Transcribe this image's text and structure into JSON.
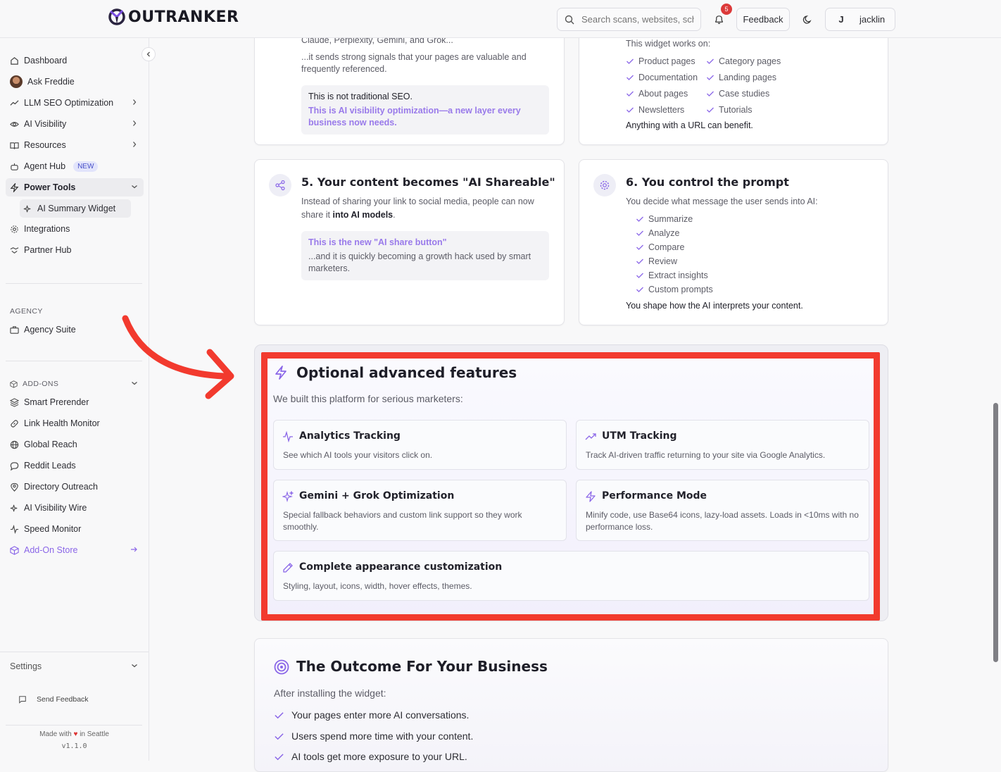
{
  "app": {
    "logo_text": "OUTRANKER"
  },
  "topbar": {
    "search_placeholder": "Search scans, websites, sche",
    "notif_count": "5",
    "feedback_label": "Feedback",
    "user_initial": "J",
    "user_name": "jacklin"
  },
  "sidebar": {
    "items": [
      {
        "label": "Dashboard",
        "icon": "home-icon"
      },
      {
        "label": "Ask Freddie",
        "icon": "avatar"
      },
      {
        "label": "LLM SEO Optimization",
        "icon": "trend-icon"
      },
      {
        "label": "AI Visibility",
        "icon": "eye-icon"
      },
      {
        "label": "Resources",
        "icon": "book-icon"
      },
      {
        "label": "Agent Hub",
        "badge": "NEW",
        "icon": "bot-icon"
      },
      {
        "label": "Power Tools",
        "icon": "zap-icon"
      },
      {
        "label": "AI Summary Widget",
        "icon": "sparkles-icon"
      },
      {
        "label": "Integrations",
        "icon": "gear-icon"
      },
      {
        "label": "Partner Hub",
        "icon": "handshake-icon"
      }
    ],
    "agency_label": "AGENCY",
    "agency_item": "Agency Suite",
    "addons_label": "ADD-ONS",
    "addons": [
      "Smart Prerender",
      "Link Health Monitor",
      "Global Reach",
      "Reddit Leads",
      "Directory Outreach",
      "AI Visibility Wire",
      "Speed Monitor"
    ],
    "addon_store": "Add-On Store",
    "settings_label": "Settings",
    "send_feedback": "Send Feedback",
    "made_with_prefix": "Made with",
    "made_with_suffix": "in Seattle",
    "version": "v1.1.0"
  },
  "card_top_left": {
    "line1": "Claude, Perplexity, Gemini, and Grok...",
    "line2": "...it sends strong signals that your pages are valuable and frequently referenced.",
    "callout_title": "This is not traditional SEO.",
    "callout_body": "This is AI visibility optimization—a new layer every business now needs."
  },
  "card_top_right": {
    "intro": "This widget works on:",
    "col1": [
      "Product pages",
      "Documentation",
      "About pages",
      "Newsletters"
    ],
    "col2": [
      "Category pages",
      "Landing pages",
      "Case studies",
      "Tutorials"
    ],
    "footer": "Anything with a URL can benefit."
  },
  "card5": {
    "title": "5. Your content becomes \"AI Shareable\"",
    "body_prefix": "Instead of sharing your link to social media, people can now share it",
    "body_bold": "into AI models",
    "body_suffix": ".",
    "callout_title": "This is the new \"AI share button\"",
    "callout_body": "...and it is quickly becoming a growth hack used by smart marketers."
  },
  "card6": {
    "title": "6. You control the prompt",
    "intro": "You decide what message the user sends into AI:",
    "items": [
      "Summarize",
      "Analyze",
      "Compare",
      "Review",
      "Extract insights",
      "Custom prompts"
    ],
    "footer": "You shape how the AI interprets your content."
  },
  "advanced": {
    "title": "Optional advanced features",
    "subtitle": "We built this platform for serious marketers:",
    "features": [
      {
        "title": "Analytics Tracking",
        "desc": "See which AI tools your visitors click on.",
        "icon": "activity-icon"
      },
      {
        "title": "UTM Tracking",
        "desc": "Track AI-driven traffic returning to your site via Google Analytics.",
        "icon": "trending-up-icon"
      },
      {
        "title": "Gemini + Grok Optimization",
        "desc": "Special fallback behaviors and custom link support so they work smoothly.",
        "icon": "sparkles-icon"
      },
      {
        "title": "Performance Mode",
        "desc": "Minify code, use Base64 icons, lazy-load assets. Loads in <10ms with no performance loss.",
        "icon": "zap-icon"
      },
      {
        "title": "Complete appearance customization",
        "desc": "Styling, layout, icons, width, hover effects, themes.",
        "icon": "pencil-icon"
      }
    ]
  },
  "outcome": {
    "title": "The Outcome For Your Business",
    "subtitle": "After installing the widget:",
    "items": [
      "Your pages enter more AI conversations.",
      "Users spend more time with your content.",
      "AI tools get more exposure to your URL."
    ]
  },
  "colors": {
    "accent": "#8a66e8",
    "highlight_border": "#f23a2e",
    "arrow": "#f23a2e"
  }
}
